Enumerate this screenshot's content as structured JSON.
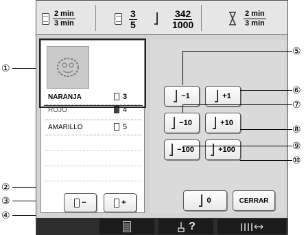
{
  "status": {
    "time_a": {
      "num": "2 min",
      "den": "3 min"
    },
    "color_step": {
      "num": "3",
      "den": "5"
    },
    "stitches": {
      "num": "342",
      "den": "1000"
    },
    "time_b": {
      "num": "2 min",
      "den": "3 min"
    }
  },
  "colors": [
    {
      "name": "NARANJA",
      "num": "3",
      "selected": true
    },
    {
      "name": "ROJO",
      "num": "4"
    },
    {
      "name": "AMARILLO",
      "num": "5"
    }
  ],
  "buttons": {
    "minus1": "−1",
    "plus1": "+1",
    "minus10": "−10",
    "plus10": "+10",
    "minus100": "−100",
    "plus100": "+100",
    "zero": "0",
    "close": "CERRAR",
    "color_minus": "−",
    "color_plus": "+"
  },
  "toolbar": {
    "help": "?"
  },
  "callouts": [
    "①",
    "②",
    "③",
    "④",
    "⑤",
    "⑥",
    "⑦",
    "⑧",
    "⑨",
    "⑩"
  ]
}
